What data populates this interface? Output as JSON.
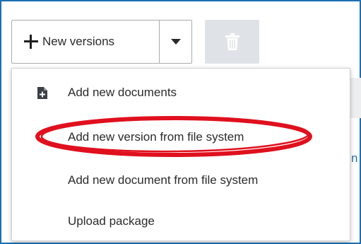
{
  "toolbar": {
    "new_versions_label": "New versions",
    "icons": {
      "add": "plus-icon",
      "dropdown": "chevron-down-icon",
      "delete": "trash-icon"
    }
  },
  "menu": {
    "items": [
      {
        "label": "Add new documents",
        "icon": "document-add-icon"
      },
      {
        "label": "Add new version from file system"
      },
      {
        "label": "Add new document from file system"
      },
      {
        "label": "Upload package"
      }
    ]
  },
  "background": {
    "partial_text": "n"
  },
  "colors": {
    "frame_border": "#1b6fb3",
    "annotation_ellipse": "#e0101e",
    "disabled_button_bg": "#dfe3e8"
  }
}
